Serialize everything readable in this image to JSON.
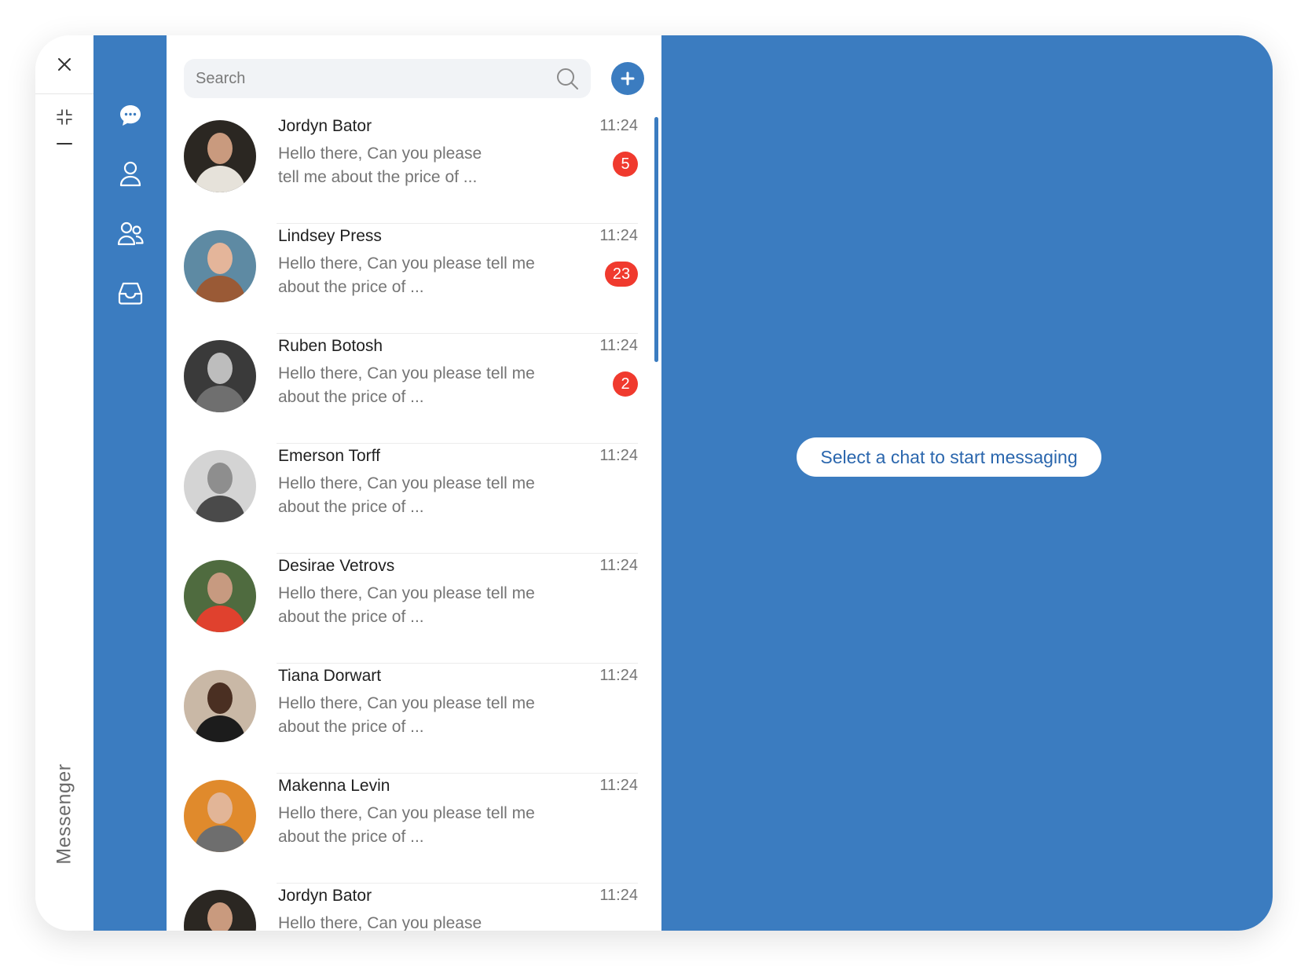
{
  "app": {
    "name": "Messenger"
  },
  "window_controls": [
    "close-icon",
    "collapse-icon",
    "minimize-icon"
  ],
  "nav": [
    "chats-icon",
    "contacts-icon",
    "groups-icon",
    "inbox-icon"
  ],
  "search": {
    "placeholder": "Search"
  },
  "chats": [
    {
      "name": "Jordyn Bator",
      "preview": "Hello there, Can you please tell me about the price of ...",
      "time": "11:24",
      "unread": "5"
    },
    {
      "name": "Lindsey Press",
      "preview": "Hello there, Can you please tell me about the price of ...",
      "time": "11:24",
      "unread": "23"
    },
    {
      "name": "Ruben Botosh",
      "preview": "Hello there, Can you please tell me about the price of ...",
      "time": "11:24",
      "unread": "2"
    },
    {
      "name": "Emerson Torff",
      "preview": "Hello there, Can you please tell me about the price of ...",
      "time": "11:24",
      "unread": ""
    },
    {
      "name": "Desirae Vetrovs",
      "preview": "Hello there, Can you please tell me about the price of ...",
      "time": "11:24",
      "unread": ""
    },
    {
      "name": "Tiana Dorwart",
      "preview": "Hello there, Can you please tell me about the price of ...",
      "time": "11:24",
      "unread": ""
    },
    {
      "name": "Makenna Levin",
      "preview": "Hello there, Can you please tell me about the price of ...",
      "time": "11:24",
      "unread": ""
    },
    {
      "name": "Jordyn Bator",
      "preview": "Hello there, Can you please tell me about the price of ...",
      "time": "11:24",
      "unread": ""
    }
  ],
  "empty_state": {
    "message": "Select a chat to start messaging"
  },
  "colors": {
    "accent": "#3b7cc0",
    "badge": "#f03a2e"
  }
}
